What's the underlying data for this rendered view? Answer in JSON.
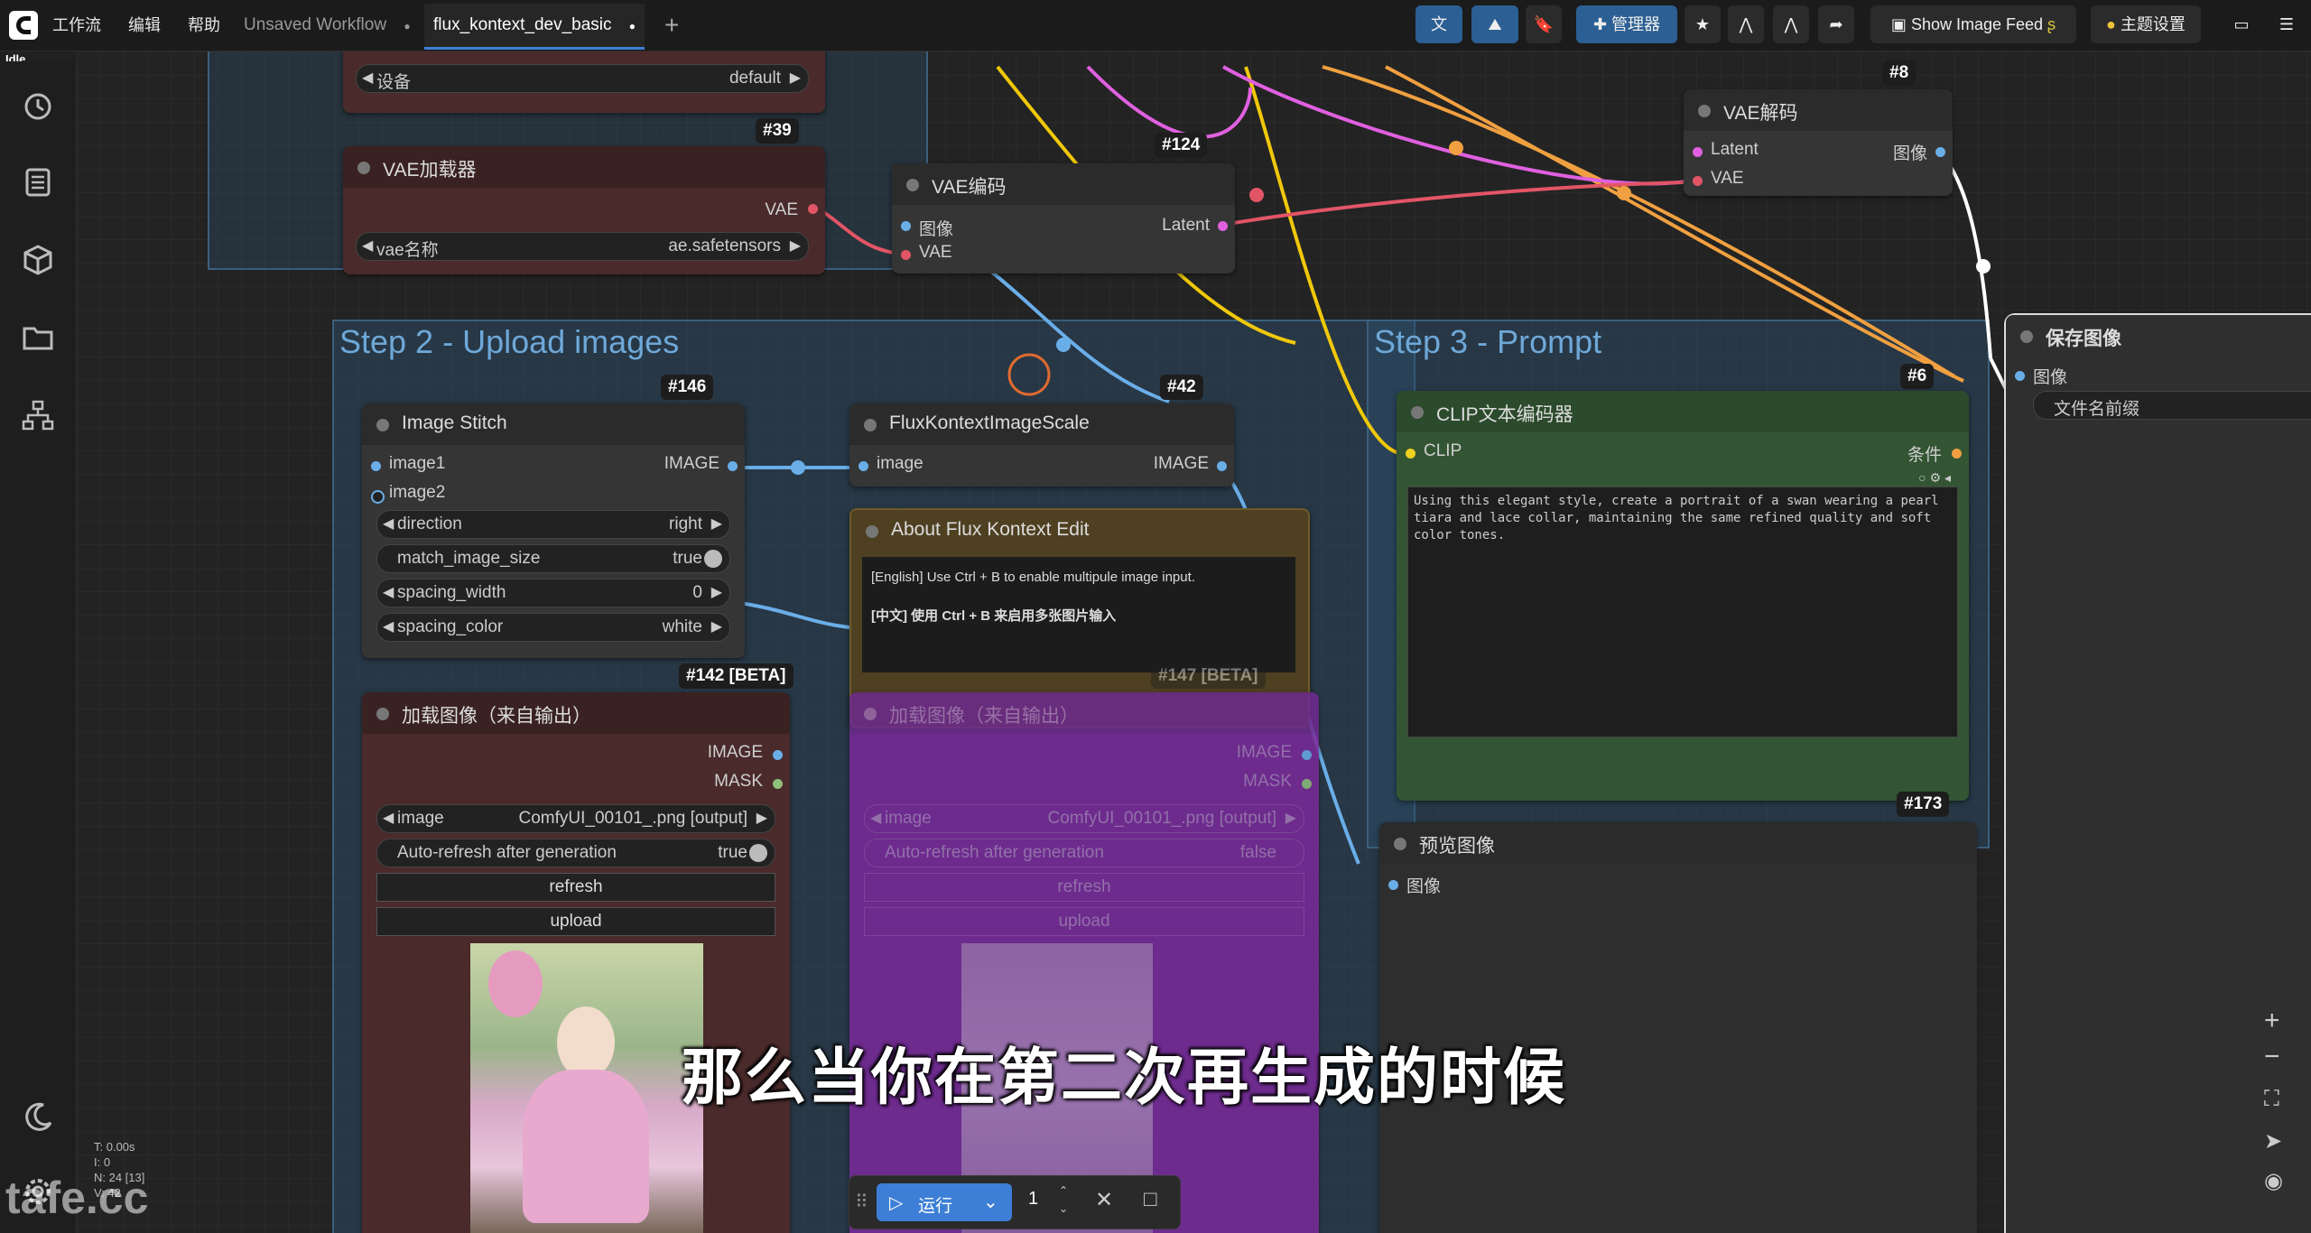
{
  "app": {
    "status": "Idle"
  },
  "menu": {
    "workflow": "工作流",
    "edit": "编辑",
    "help": "帮助"
  },
  "tabs": [
    {
      "label": "Unsaved Workflow",
      "dot": "●"
    },
    {
      "label": "flux_kontext_dev_basic",
      "dot": "●"
    }
  ],
  "toolbar": {
    "manager": "管理器",
    "show_image_feed": "Show Image Feed",
    "theme": "主题设置"
  },
  "groups": {
    "step2": "Step 2 - Upload images",
    "step3": "Step 3 - Prompt"
  },
  "nodes": {
    "device": {
      "label": "设备",
      "value": "default",
      "badge": "#39"
    },
    "vae_loader": {
      "title": "VAE加载器",
      "out": "VAE",
      "widget_label": "vae名称",
      "widget_value": "ae.safetensors"
    },
    "vae_encode": {
      "title": "VAE编码",
      "badge": "#124",
      "in1": "图像",
      "in2": "VAE",
      "out": "Latent"
    },
    "vae_decode": {
      "title": "VAE解码",
      "badge": "#8",
      "in1": "Latent",
      "in2": "VAE",
      "out": "图像"
    },
    "save_image": {
      "title": "保存图像",
      "in": "图像",
      "prefix_label": "文件名前缀"
    },
    "image_stitch": {
      "title": "Image Stitch",
      "badge": "#146",
      "in1": "image1",
      "in2": "image2",
      "out": "IMAGE",
      "w1_label": "direction",
      "w1_value": "right",
      "w2_label": "match_image_size",
      "w2_value": "true",
      "w3_label": "spacing_width",
      "w3_value": "0",
      "w4_label": "spacing_color",
      "w4_value": "white"
    },
    "flux_scale": {
      "title": "FluxKontextImageScale",
      "badge": "#42",
      "in": "image",
      "out": "IMAGE"
    },
    "about": {
      "title": "About Flux Kontext Edit",
      "line1": "[English] Use Ctrl + B to enable multipule image input.",
      "line2": "[中文] 使用 Ctrl + B 来启用多张图片输入"
    },
    "clip": {
      "title": "CLIP文本编码器",
      "badge": "#6",
      "in": "CLIP",
      "out": "条件",
      "text": "Using this elegant style, create a portrait of a swan wearing a pearl tiara and lace collar, maintaining the same refined quality and soft color tones."
    },
    "load_image": {
      "title": "加载图像（来自输出）",
      "badge": "#142 [BETA]",
      "out1": "IMAGE",
      "out2": "MASK",
      "w1_label": "image",
      "w1_value": "ComfyUI_00101_.png [output]",
      "w2_label": "Auto-refresh after generation",
      "w2_value": "true",
      "btn1": "refresh",
      "btn2": "upload"
    },
    "load_image2": {
      "title": "加载图像（来自输出）",
      "badge": "#147 [BETA]",
      "out1": "IMAGE",
      "out2": "MASK",
      "w1_label": "image",
      "w1_value": "ComfyUI_00101_.png [output]",
      "w2_label": "Auto-refresh after generation",
      "w2_value": "false",
      "btn1": "refresh",
      "btn2": "upload"
    },
    "preview": {
      "title": "预览图像",
      "badge": "#173",
      "in": "图像"
    }
  },
  "run": {
    "label": "运行",
    "count": "1"
  },
  "stats": {
    "t": "T: 0.00s",
    "i": "I: 0",
    "n": "N: 24 [13]",
    "v": "V: 42"
  },
  "subtitle": "那么当你在第二次再生成的时候",
  "watermark": "tafe.cc",
  "colors": {
    "accent": "#3d7fd6",
    "group": "#6ea8d8",
    "clip_node": "#335533",
    "load_node": "#4a2a2a",
    "load2_node": "#7a2a9a",
    "about_node": "#4e4021"
  }
}
